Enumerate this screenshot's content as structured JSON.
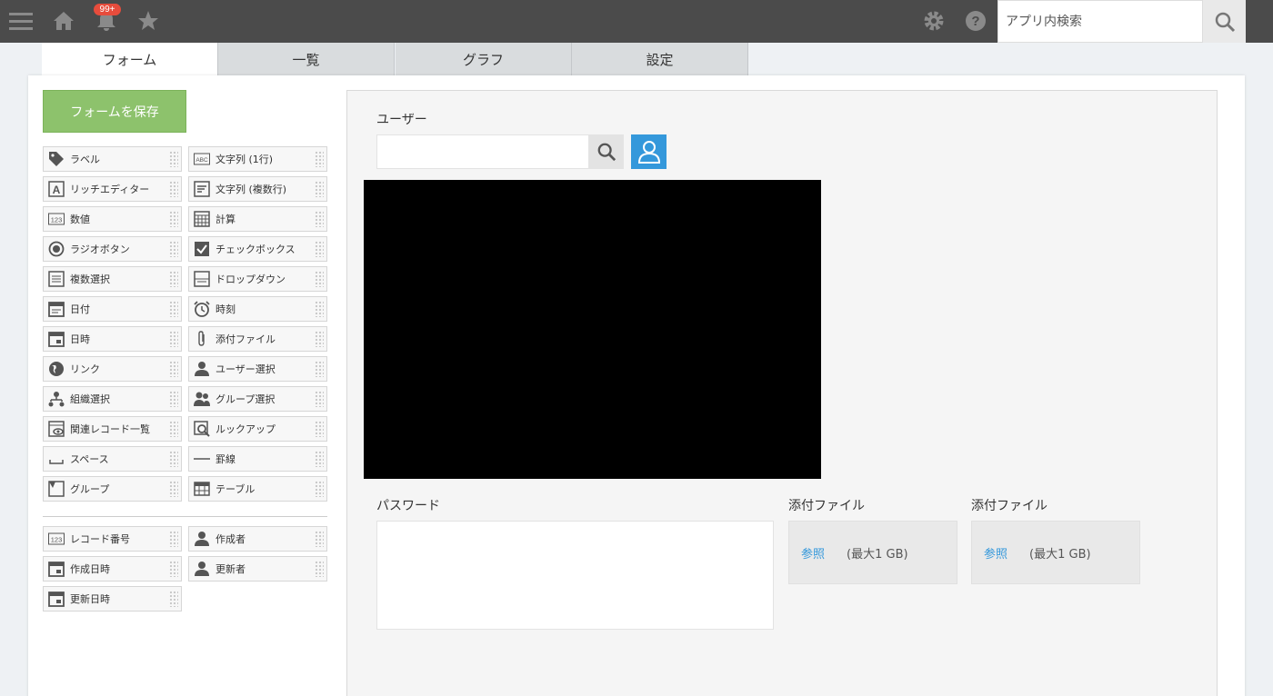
{
  "header": {
    "notification_badge": "99+",
    "search_placeholder": "アプリ内検索",
    "icons": [
      "menu-icon",
      "home-icon",
      "bell-icon",
      "star-icon",
      "gear-icon",
      "help-icon",
      "search-icon"
    ]
  },
  "tabs": [
    "フォーム",
    "一覧",
    "グラフ",
    "設定"
  ],
  "save_button": "フォームを保存",
  "palette": {
    "left": [
      "ラベル",
      "リッチエディター",
      "数値",
      "ラジオボタン",
      "複数選択",
      "日付",
      "日時",
      "リンク",
      "組織選択",
      "関連レコード一覧",
      "スペース",
      "グループ"
    ],
    "right": [
      "文字列 (1行)",
      "文字列 (複数行)",
      "計算",
      "チェックボックス",
      "ドロップダウン",
      "時刻",
      "添付ファイル",
      "ユーザー選択",
      "グループ選択",
      "ルックアップ",
      "罫線",
      "テーブル"
    ],
    "system_left": [
      "レコード番号",
      "作成日時",
      "更新日時"
    ],
    "system_right": [
      "作成者",
      "更新者"
    ]
  },
  "canvas": {
    "user_label": "ユーザー",
    "password_label": "パスワード",
    "file1_label": "添付ファイル",
    "file1_browse": "参照",
    "file1_limit": "(最大1 GB)",
    "file2_label": "添付ファイル",
    "file2_browse": "参照",
    "file2_limit": "(最大1 GB)"
  },
  "colors": {
    "header": "#4b4b4b",
    "save": "#8dc26c",
    "accent": "#3498db"
  }
}
